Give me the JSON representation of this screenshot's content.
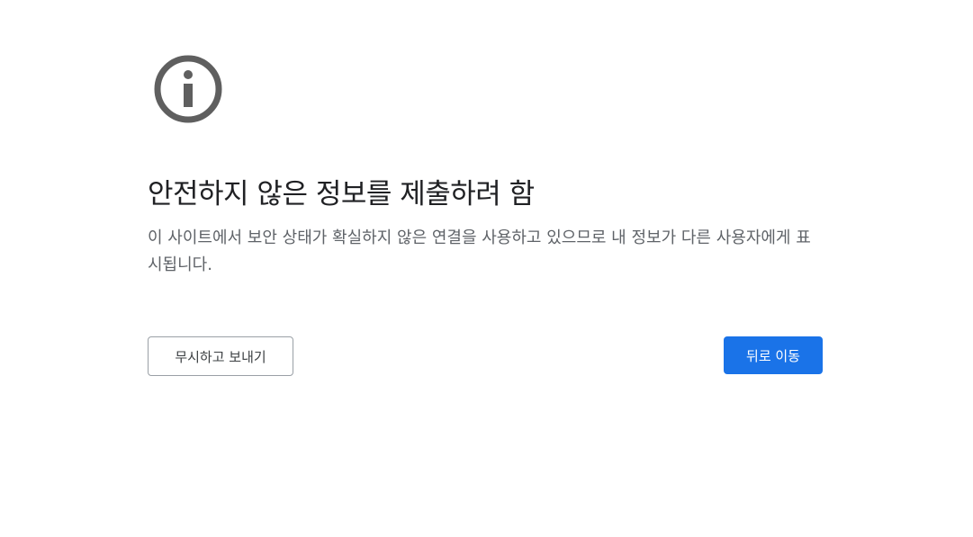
{
  "page": {
    "title": "안전하지 않은 정보를 제출하려 함",
    "description": "이 사이트에서 보안 상태가 확실하지 않은 연결을 사용하고 있으므로 내 정보가 다른 사용자에게 표시됩니다.",
    "icon": "info-circle-icon"
  },
  "actions": {
    "send_anyway_label": "무시하고 보내기",
    "go_back_label": "뒤로 이동"
  },
  "colors": {
    "primary": "#1a73e8",
    "icon": "#5f5f5f",
    "title": "#202124",
    "body_text": "#5f6368"
  }
}
